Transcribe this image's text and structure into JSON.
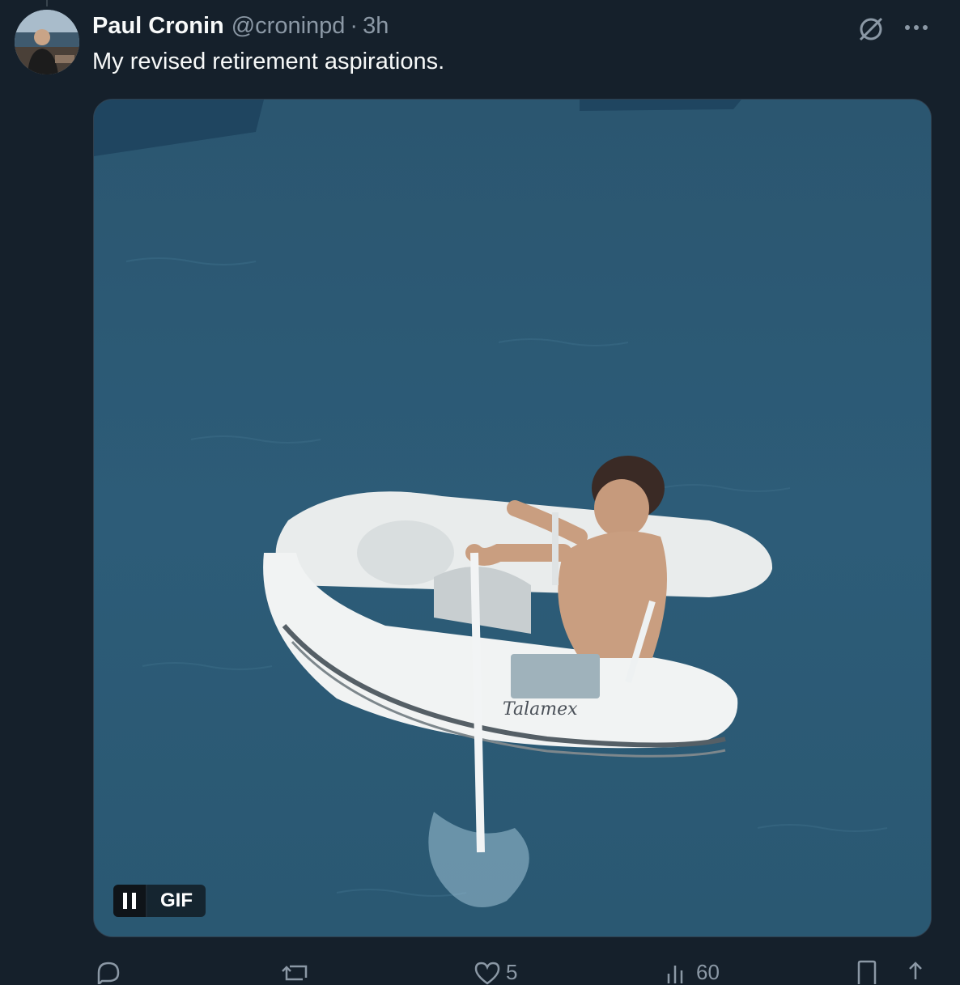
{
  "tweet": {
    "author_name": "Paul Cronin",
    "handle": "@croninpd",
    "separator": "·",
    "time": "3h",
    "text": "My revised retirement aspirations."
  },
  "media": {
    "gif_label": "GIF",
    "boat_text": "Talamex"
  },
  "actions": {
    "reply_count": "",
    "retweet_count": "",
    "like_count": "5",
    "views_count": "60"
  },
  "colors": {
    "background": "#15202b",
    "text_primary": "#f7f9f9",
    "text_secondary": "#8b98a5",
    "water": "#2e5a75"
  }
}
